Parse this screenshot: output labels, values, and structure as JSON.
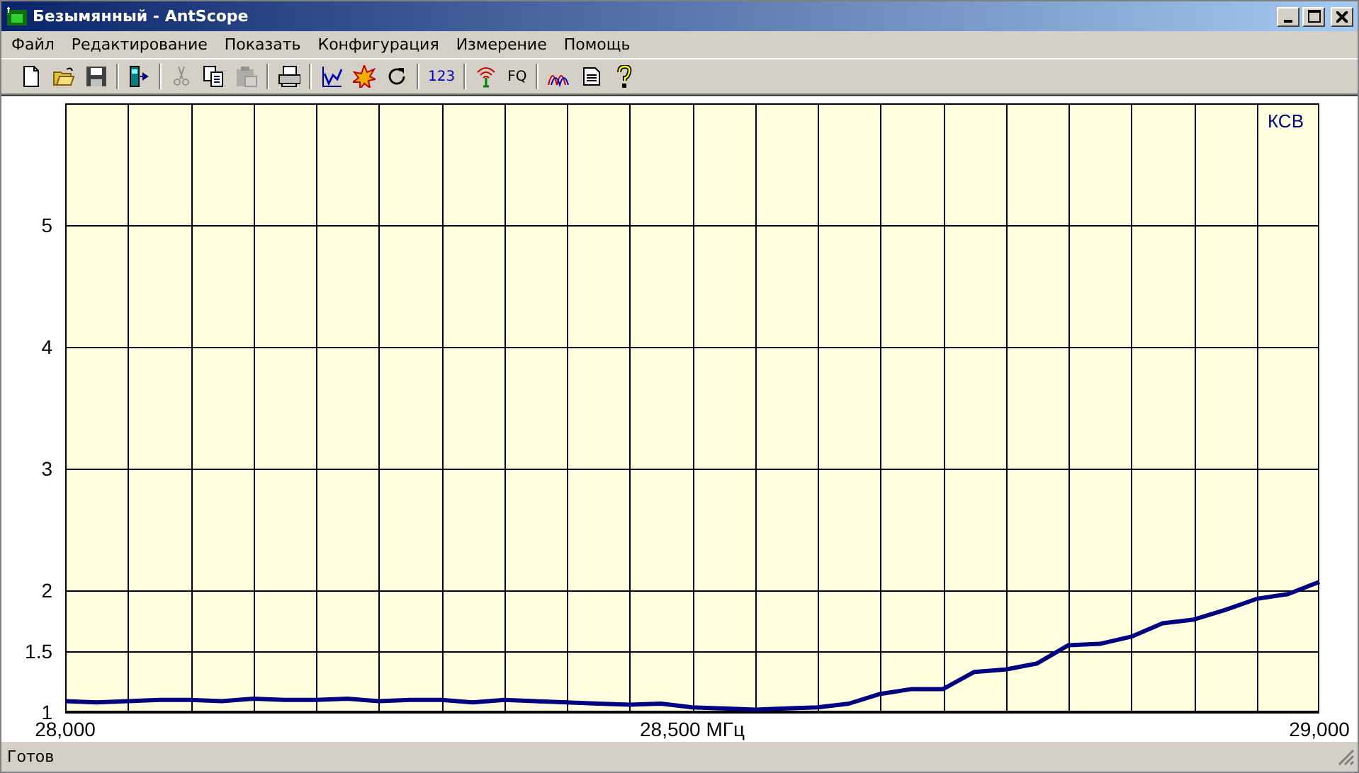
{
  "window": {
    "title": "Безымянный - AntScope"
  },
  "menu": [
    {
      "label": "Файл"
    },
    {
      "label": "Редактирование"
    },
    {
      "label": "Показать"
    },
    {
      "label": "Конфигурация"
    },
    {
      "label": "Измерение"
    },
    {
      "label": "Помощь"
    }
  ],
  "toolbar": [
    [
      {
        "kind": "new"
      },
      {
        "kind": "open"
      },
      {
        "kind": "save"
      }
    ],
    [
      {
        "kind": "device"
      }
    ],
    [
      {
        "kind": "cut",
        "disabled": true
      },
      {
        "kind": "copy",
        "disabled": false
      },
      {
        "kind": "paste",
        "disabled": true
      }
    ],
    [
      {
        "kind": "print"
      }
    ],
    [
      {
        "kind": "chart"
      },
      {
        "kind": "burst"
      },
      {
        "kind": "refresh"
      }
    ],
    [
      {
        "kind": "text",
        "label": "123",
        "color": "#0000c0"
      }
    ],
    [
      {
        "kind": "antenna"
      },
      {
        "kind": "text",
        "label": "FQ",
        "color": "#000000"
      }
    ],
    [
      {
        "kind": "curves"
      },
      {
        "kind": "list"
      },
      {
        "kind": "help"
      }
    ]
  ],
  "plot": {
    "chart_data": {
      "type": "line",
      "ylabel": "КСВ",
      "categories": [
        "28,000",
        null,
        null,
        null,
        null,
        null,
        null,
        null,
        null,
        null,
        null,
        null,
        null,
        null,
        null,
        null,
        null,
        null,
        null,
        null,
        "28,500 МГц",
        null,
        null,
        null,
        null,
        null,
        null,
        null,
        null,
        null,
        null,
        null,
        null,
        null,
        null,
        null,
        null,
        null,
        null,
        null,
        "29,000"
      ],
      "series": [
        {
          "color": "#000080",
          "values": [
            1.09,
            1.08,
            1.09,
            1.1,
            1.1,
            1.09,
            1.11,
            1.1,
            1.1,
            1.11,
            1.09,
            1.1,
            1.1,
            1.08,
            1.1,
            1.09,
            1.08,
            1.07,
            1.06,
            1.07,
            1.04,
            1.03,
            1.02,
            1.03,
            1.04,
            1.07,
            1.15,
            1.19,
            1.19,
            1.33,
            1.35,
            1.4,
            1.55,
            1.56,
            1.62,
            1.73,
            1.76,
            1.84,
            1.93,
            1.97,
            2.07
          ]
        }
      ],
      "ylim": [
        1,
        6
      ],
      "grid": true,
      "yticks": [
        1,
        1.5,
        2,
        3,
        4,
        5
      ]
    }
  },
  "status_bar": {
    "text": "Готов"
  }
}
